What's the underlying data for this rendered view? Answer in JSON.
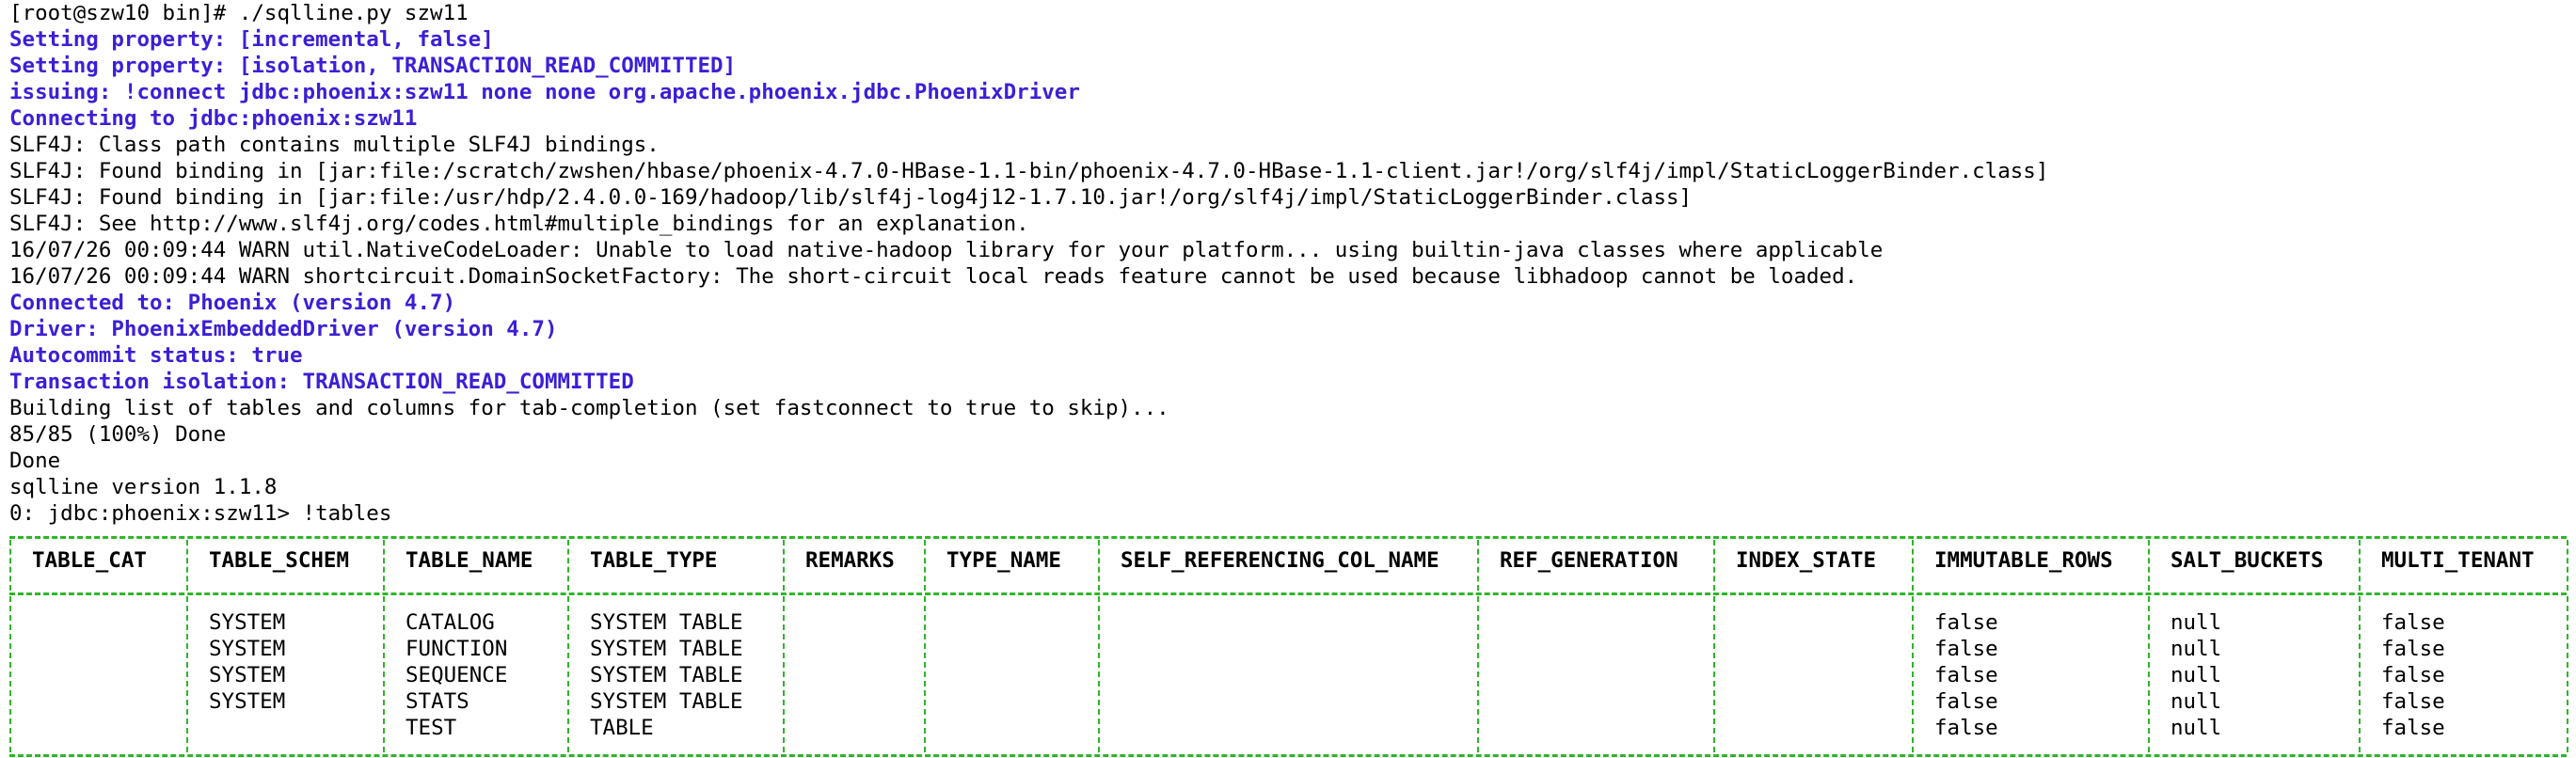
{
  "terminal": {
    "lines": [
      {
        "text": "[root@szw10 bin]# ./sqlline.py szw11",
        "style": "plain"
      },
      {
        "text": "Setting property: [incremental, false]",
        "style": "info"
      },
      {
        "text": "Setting property: [isolation, TRANSACTION_READ_COMMITTED]",
        "style": "info"
      },
      {
        "text": "issuing: !connect jdbc:phoenix:szw11 none none org.apache.phoenix.jdbc.PhoenixDriver",
        "style": "info"
      },
      {
        "text": "Connecting to jdbc:phoenix:szw11",
        "style": "info"
      },
      {
        "text": "SLF4J: Class path contains multiple SLF4J bindings.",
        "style": "plain"
      },
      {
        "text": "SLF4J: Found binding in [jar:file:/scratch/zwshen/hbase/phoenix-4.7.0-HBase-1.1-bin/phoenix-4.7.0-HBase-1.1-client.jar!/org/slf4j/impl/StaticLoggerBinder.class]",
        "style": "plain"
      },
      {
        "text": "SLF4J: Found binding in [jar:file:/usr/hdp/2.4.0.0-169/hadoop/lib/slf4j-log4j12-1.7.10.jar!/org/slf4j/impl/StaticLoggerBinder.class]",
        "style": "plain"
      },
      {
        "text": "SLF4J: See http://www.slf4j.org/codes.html#multiple_bindings for an explanation.",
        "style": "plain"
      },
      {
        "text": "16/07/26 00:09:44 WARN util.NativeCodeLoader: Unable to load native-hadoop library for your platform... using builtin-java classes where applicable",
        "style": "plain"
      },
      {
        "text": "16/07/26 00:09:44 WARN shortcircuit.DomainSocketFactory: The short-circuit local reads feature cannot be used because libhadoop cannot be loaded.",
        "style": "plain"
      },
      {
        "text": "Connected to: Phoenix (version 4.7)",
        "style": "info"
      },
      {
        "text": "Driver: PhoenixEmbeddedDriver (version 4.7)",
        "style": "info"
      },
      {
        "text": "Autocommit status: true",
        "style": "info"
      },
      {
        "text": "Transaction isolation: TRANSACTION_READ_COMMITTED",
        "style": "info"
      },
      {
        "text": "Building list of tables and columns for tab-completion (set fastconnect to true to skip)...",
        "style": "plain"
      },
      {
        "text": "85/85 (100%) Done",
        "style": "plain"
      },
      {
        "text": "Done",
        "style": "plain"
      },
      {
        "text": "sqlline version 1.1.8",
        "style": "plain"
      },
      {
        "text": "0: jdbc:phoenix:szw11> !tables",
        "style": "plain"
      }
    ],
    "table": {
      "columns": [
        "TABLE_CAT",
        "TABLE_SCHEM",
        "TABLE_NAME",
        "TABLE_TYPE",
        "REMARKS",
        "TYPE_NAME",
        "SELF_REFERENCING_COL_NAME",
        "REF_GENERATION",
        "INDEX_STATE",
        "IMMUTABLE_ROWS",
        "SALT_BUCKETS",
        "MULTI_TENANT"
      ],
      "rows": [
        [
          "",
          "SYSTEM",
          "CATALOG",
          "SYSTEM TABLE",
          "",
          "",
          "",
          "",
          "",
          "false",
          "null",
          "false"
        ],
        [
          "",
          "SYSTEM",
          "FUNCTION",
          "SYSTEM TABLE",
          "",
          "",
          "",
          "",
          "",
          "false",
          "null",
          "false"
        ],
        [
          "",
          "SYSTEM",
          "SEQUENCE",
          "SYSTEM TABLE",
          "",
          "",
          "",
          "",
          "",
          "false",
          "null",
          "false"
        ],
        [
          "",
          "SYSTEM",
          "STATS",
          "SYSTEM TABLE",
          "",
          "",
          "",
          "",
          "",
          "false",
          "null",
          "false"
        ],
        [
          "",
          "",
          "TEST",
          "TABLE",
          "",
          "",
          "",
          "",
          "",
          "false",
          "null",
          "false"
        ]
      ]
    },
    "colors": {
      "info_text": "#3b1fd6",
      "table_border": "#2fb52a",
      "plain_text": "#000000"
    }
  }
}
